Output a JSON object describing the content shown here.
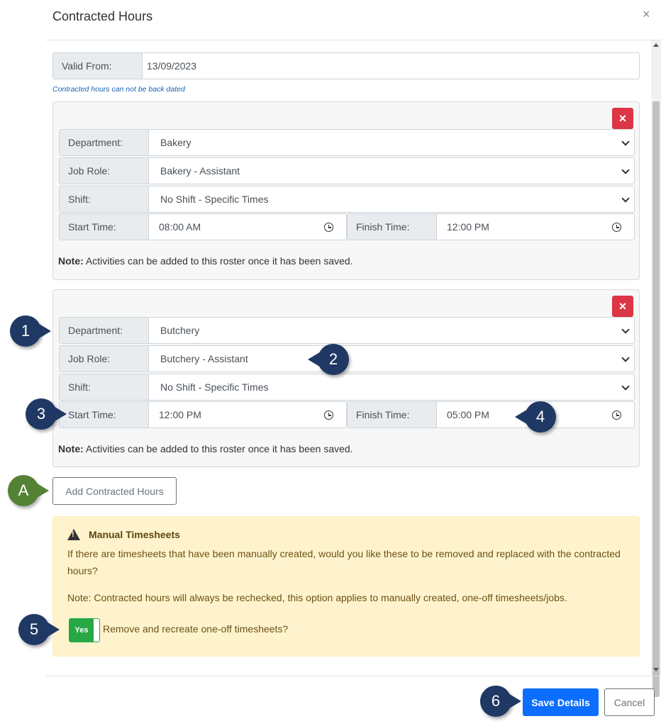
{
  "modal": {
    "title": "Contracted Hours",
    "close": "×"
  },
  "valid_from": {
    "label": "Valid From:",
    "value": "13/09/2023",
    "hint": "Contracted hours can not be back dated"
  },
  "rosters": [
    {
      "delete": "×",
      "department": {
        "label": "Department:",
        "value": "Bakery"
      },
      "job_role": {
        "label": "Job Role:",
        "value": "Bakery - Assistant"
      },
      "shift": {
        "label": "Shift:",
        "value": "No Shift - Specific Times"
      },
      "start_time": {
        "label": "Start Time:",
        "value": "08:00 AM"
      },
      "finish_time": {
        "label": "Finish Time:",
        "value": "12:00 PM"
      },
      "note_bold": "Note:",
      "note_text": "Activities can be added to this roster once it has been saved."
    },
    {
      "delete": "×",
      "department": {
        "label": "Department:",
        "value": "Butchery"
      },
      "job_role": {
        "label": "Job Role:",
        "value": "Butchery - Assistant"
      },
      "shift": {
        "label": "Shift:",
        "value": "No Shift - Specific Times"
      },
      "start_time": {
        "label": "Start Time:",
        "value": "12:00 PM"
      },
      "finish_time": {
        "label": "Finish Time:",
        "value": "05:00 PM"
      },
      "note_bold": "Note:",
      "note_text": "Activities can be added to this roster once it has been saved."
    }
  ],
  "add_button": "Add Contracted Hours",
  "manual_timesheets": {
    "title": "Manual Timesheets",
    "text": "If there are timesheets that have been manually created, would you like these to be removed and replaced with the contracted hours?",
    "note": "Note: Contracted hours will always be rechecked, this option applies to manually created, one-off timesheets/jobs.",
    "toggle_value": "Yes",
    "toggle_label": "Remove and recreate one-off timesheets?"
  },
  "footer": {
    "save": "Save Details",
    "cancel": "Cancel"
  },
  "callouts": [
    "1",
    "2",
    "3",
    "4",
    "A",
    "5",
    "6"
  ],
  "colors": {
    "callout_blue": "#1f3864",
    "callout_green": "#548235",
    "primary": "#0d6efd",
    "danger": "#dc3545",
    "success": "#28a745",
    "warning_bg": "#fff3cd"
  }
}
